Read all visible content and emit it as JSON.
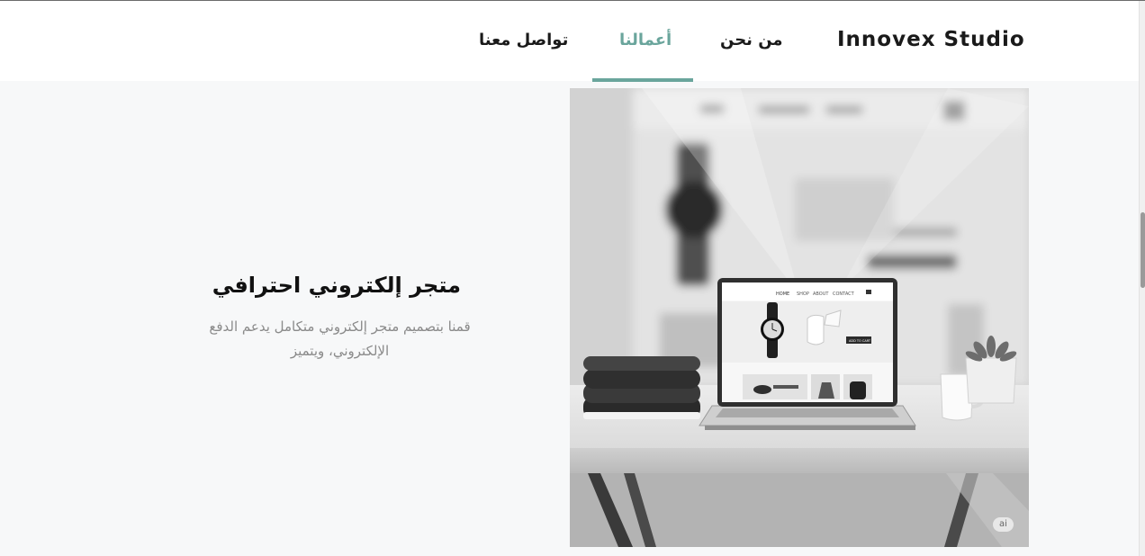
{
  "header": {
    "brand": "Innovex Studio",
    "nav": {
      "about": "من نحن",
      "work": "أعمالنا",
      "contact": "تواصل معنا"
    },
    "accent_color": "#6aa59c"
  },
  "project": {
    "title": "متجر إلكتروني احترافي",
    "description": "قمنا بتصميم متجر إلكتروني متكامل يدعم الدفع الإلكتروني، ويتميز",
    "image": {
      "badge": "ai",
      "mockup_nav": [
        "HOME",
        "SHOP",
        "ABOUT",
        "CONTACT"
      ],
      "mockup_button": "ADD TO CART"
    }
  }
}
